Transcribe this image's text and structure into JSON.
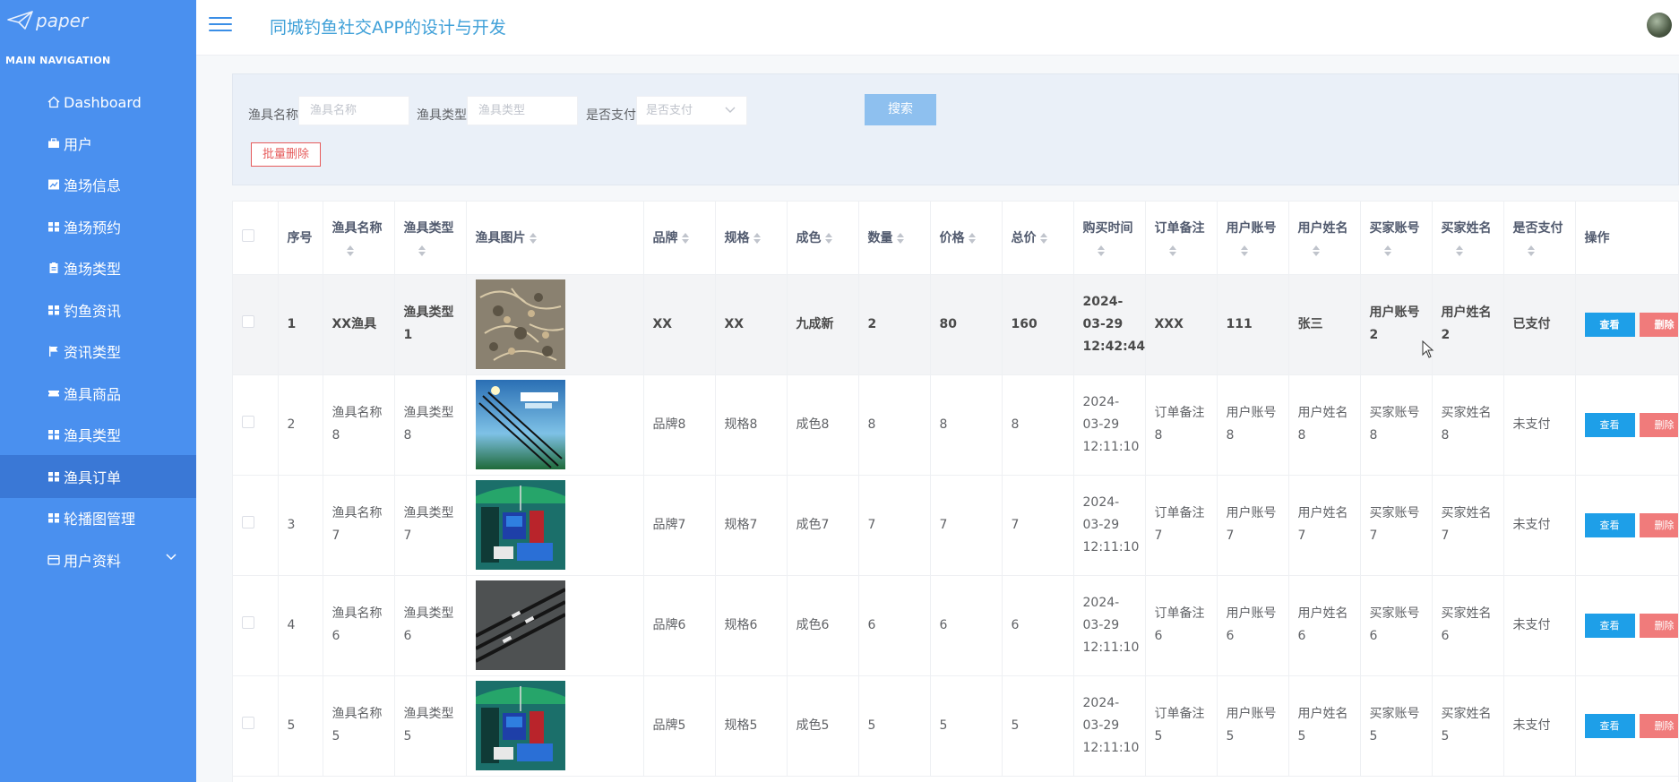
{
  "app": {
    "logo_text": "paper",
    "title": "同城钓鱼社交APP的设计与开发"
  },
  "sidebar": {
    "section_label": "MAIN NAVIGATION",
    "items": [
      {
        "label": "Dashboard",
        "icon": "home-icon"
      },
      {
        "label": "用户",
        "icon": "briefcase-icon"
      },
      {
        "label": "渔场信息",
        "icon": "chart-icon"
      },
      {
        "label": "渔场预约",
        "icon": "grid-icon"
      },
      {
        "label": "渔场类型",
        "icon": "clipboard-icon"
      },
      {
        "label": "钓鱼资讯",
        "icon": "grid-icon"
      },
      {
        "label": "资讯类型",
        "icon": "flag-icon"
      },
      {
        "label": "渔具商品",
        "icon": "ticket-icon"
      },
      {
        "label": "渔具类型",
        "icon": "grid-icon"
      },
      {
        "label": "渔具订单",
        "icon": "grid-icon",
        "active": true
      },
      {
        "label": "轮播图管理",
        "icon": "grid-icon"
      },
      {
        "label": "用户资料",
        "icon": "card-icon",
        "expandable": true
      }
    ]
  },
  "search": {
    "name_label": "渔具名称",
    "name_placeholder": "渔具名称",
    "type_label": "渔具类型",
    "type_placeholder": "渔具类型",
    "paid_label": "是否支付",
    "paid_placeholder": "是否支付",
    "search_button": "搜索",
    "batch_delete_button": "批量删除"
  },
  "table": {
    "headers": [
      "序号",
      "渔具名称",
      "渔具类型",
      "渔具图片",
      "品牌",
      "规格",
      "成色",
      "数量",
      "价格",
      "总价",
      "购买时间",
      "订单备注",
      "用户账号",
      "用户姓名",
      "买家账号",
      "买家姓名",
      "是否支付",
      "操作"
    ],
    "view_label": "查看",
    "delete_label": "删除",
    "rows": [
      {
        "no": "1",
        "name": "XX渔具",
        "type": "渔具类型1",
        "image": "shrimp-photo",
        "brand": "XX",
        "spec": "XX",
        "condition": "九成新",
        "qty": "2",
        "price": "80",
        "total": "160",
        "time": "2024-03-29 12:42:44",
        "note": "XXX",
        "user_account": "111",
        "user_name": "张三",
        "buyer_account": "用户账号2",
        "buyer_name": "用户姓名2",
        "paid": "已支付"
      },
      {
        "no": "2",
        "name": "渔具名称8",
        "type": "渔具类型8",
        "image": "rod-box-photo",
        "brand": "品牌8",
        "spec": "规格8",
        "condition": "成色8",
        "qty": "8",
        "price": "8",
        "total": "8",
        "time": "2024-03-29 12:11:10",
        "note": "订单备注8",
        "user_account": "用户账号8",
        "user_name": "用户姓名8",
        "buyer_account": "买家账号8",
        "buyer_name": "买家姓名8",
        "paid": "未支付"
      },
      {
        "no": "3",
        "name": "渔具名称7",
        "type": "渔具类型7",
        "image": "umbrella-photo",
        "brand": "品牌7",
        "spec": "规格7",
        "condition": "成色7",
        "qty": "7",
        "price": "7",
        "total": "7",
        "time": "2024-03-29 12:11:10",
        "note": "订单备注7",
        "user_account": "用户账号7",
        "user_name": "用户姓名7",
        "buyer_account": "买家账号7",
        "buyer_name": "买家姓名7",
        "paid": "未支付"
      },
      {
        "no": "4",
        "name": "渔具名称6",
        "type": "渔具类型6",
        "image": "rods-photo",
        "brand": "品牌6",
        "spec": "规格6",
        "condition": "成色6",
        "qty": "6",
        "price": "6",
        "total": "6",
        "time": "2024-03-29 12:11:10",
        "note": "订单备注6",
        "user_account": "用户账号6",
        "user_name": "用户姓名6",
        "buyer_account": "买家账号6",
        "buyer_name": "买家姓名6",
        "paid": "未支付"
      },
      {
        "no": "5",
        "name": "渔具名称5",
        "type": "渔具类型5",
        "image": "umbrella-photo",
        "brand": "品牌5",
        "spec": "规格5",
        "condition": "成色5",
        "qty": "5",
        "price": "5",
        "total": "5",
        "time": "2024-03-29 12:11:10",
        "note": "订单备注5",
        "user_account": "用户账号5",
        "user_name": "用户姓名5",
        "buyer_account": "买家账号5",
        "buyer_name": "买家姓名5",
        "paid": "未支付"
      }
    ]
  },
  "colors": {
    "sidebar": "#4a90ef",
    "sidebar_active": "#3a78d6",
    "title": "#3fa0d8",
    "view_button": "#1e9fe8",
    "delete_button": "#f07b7b"
  }
}
